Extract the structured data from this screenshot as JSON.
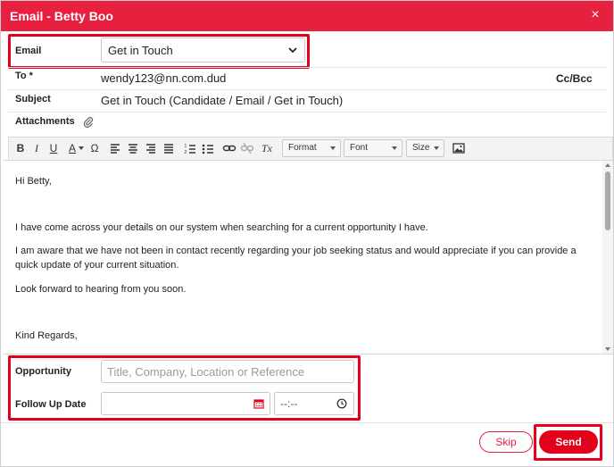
{
  "window": {
    "title": "Email - Betty Boo",
    "close_glyph": "×"
  },
  "form": {
    "email_label": "Email",
    "email_template": "Get in Touch",
    "to_label": "To *",
    "to_value": "wendy123@nn.com.dud",
    "cc_bcc_label": "Cc/Bcc",
    "subject_label": "Subject",
    "subject_value": "Get in Touch (Candidate / Email / Get in Touch)",
    "attachments_label": "Attachments"
  },
  "toolbar": {
    "bold": "B",
    "italic": "I",
    "underline": "U",
    "text_color": "A",
    "special_char": "Ω",
    "format_label": "Format",
    "font_label": "Font",
    "size_label": "Size",
    "clear_format": "Tx"
  },
  "body": {
    "greeting": "Hi Betty,",
    "para1": "I have come across your details on our system when searching for a current opportunity I have.",
    "para2": "I am aware that we have not been in contact recently regarding your job seeking status and would appreciate if you can provide a quick update of your current situation.",
    "para3": "Look forward to hearing from you soon.",
    "signoff": "Kind Regards,"
  },
  "opportunity": {
    "label": "Opportunity",
    "placeholder": "Title, Company, Location or Reference"
  },
  "follow_up": {
    "label": "Follow Up Date",
    "time_placeholder": "--:--"
  },
  "actions": {
    "skip": "Skip",
    "send": "Send"
  },
  "colors": {
    "accent": "#e8203f",
    "highlight": "#e2001a"
  }
}
